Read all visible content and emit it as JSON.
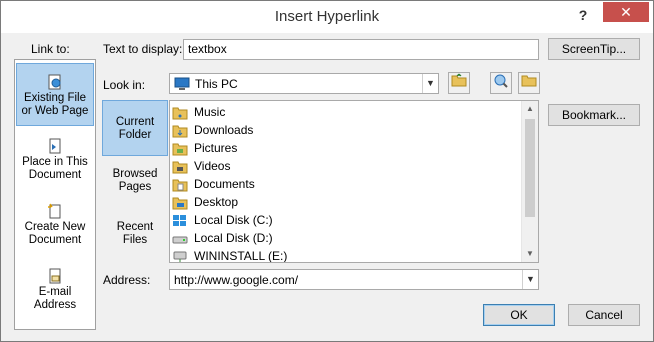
{
  "dialog": {
    "title": "Insert Hyperlink",
    "help_glyph": "?",
    "close_glyph": "✕"
  },
  "link_to": {
    "label": "Link to:",
    "items": [
      {
        "label_l1": "Existing File",
        "label_l2": "or Web Page",
        "icon": "globe-file-icon",
        "selected": true
      },
      {
        "label_l1": "Place in This",
        "label_l2": "Document",
        "icon": "document-place-icon",
        "selected": false
      },
      {
        "label_l1": "Create New",
        "label_l2": "Document",
        "icon": "new-document-icon",
        "selected": false
      },
      {
        "label_l1": "E-mail",
        "label_l2": "Address",
        "icon": "email-icon",
        "selected": false
      }
    ]
  },
  "text_to_display": {
    "label": "Text to display:",
    "value": "textbox"
  },
  "screentip_label": "ScreenTip...",
  "look_in": {
    "label": "Look in:",
    "value": "This PC",
    "icon": "computer-icon"
  },
  "bookmark_label": "Bookmark...",
  "sidenav": {
    "items": [
      {
        "label_l1": "Current",
        "label_l2": "Folder",
        "selected": true
      },
      {
        "label_l1": "Browsed",
        "label_l2": "Pages",
        "selected": false
      },
      {
        "label_l1": "Recent",
        "label_l2": "Files",
        "selected": false
      }
    ]
  },
  "files": [
    {
      "name": "Music",
      "icon": "music-folder-icon"
    },
    {
      "name": "Downloads",
      "icon": "downloads-folder-icon"
    },
    {
      "name": "Pictures",
      "icon": "pictures-folder-icon"
    },
    {
      "name": "Videos",
      "icon": "videos-folder-icon"
    },
    {
      "name": "Documents",
      "icon": "documents-folder-icon"
    },
    {
      "name": "Desktop",
      "icon": "desktop-folder-icon"
    },
    {
      "name": "Local Disk (C:)",
      "icon": "windows-drive-icon"
    },
    {
      "name": "Local Disk (D:)",
      "icon": "drive-icon"
    },
    {
      "name": "WININSTALL (E:)",
      "icon": "network-drive-icon"
    }
  ],
  "address": {
    "label": "Address:",
    "value": "http://www.google.com/"
  },
  "ok_label": "OK",
  "cancel_label": "Cancel",
  "colors": {
    "selection": "#b3d3ef",
    "close_button": "#c7504c",
    "folder": "#e8c15a"
  }
}
